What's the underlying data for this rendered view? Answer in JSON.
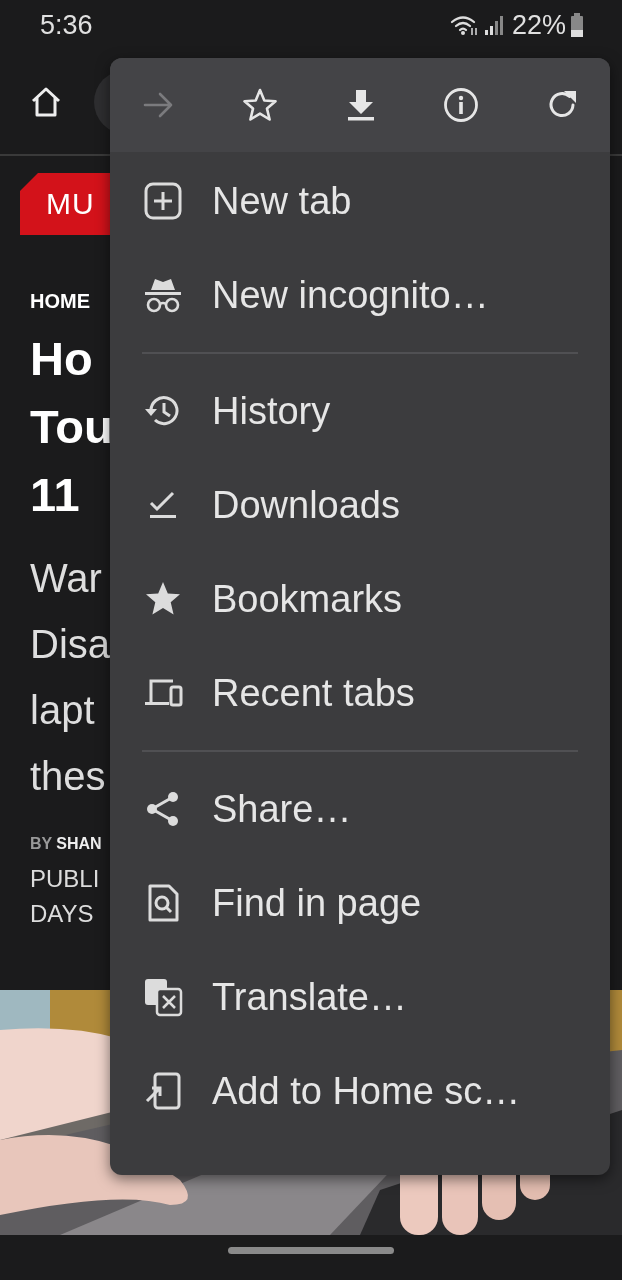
{
  "status_bar": {
    "time": "5:36",
    "battery": "22%"
  },
  "site": {
    "logo": "MU",
    "breadcrumb": "HOME",
    "title_lines": [
      "Ho",
      "Tou",
      "11"
    ],
    "summary_lines": [
      "War",
      "Disa",
      "lapt",
      "thes"
    ],
    "byline_label": "BY",
    "byline_name": "SHAN",
    "published_lines": [
      "PUBLI",
      "DAYS"
    ],
    "image": {
      "kind": "picture"
    }
  },
  "menu": {
    "toolbar": [
      {
        "kind": "forward",
        "disabled": true
      },
      {
        "kind": "bookmark",
        "disabled": false
      },
      {
        "kind": "download",
        "disabled": false
      },
      {
        "kind": "info",
        "disabled": false
      },
      {
        "kind": "refresh",
        "disabled": false
      }
    ],
    "items": [
      {
        "kind": "item",
        "label": "New tab"
      },
      {
        "kind": "item",
        "label": "New incognito…"
      },
      {
        "kind": "divider"
      },
      {
        "kind": "item",
        "label": "History"
      },
      {
        "kind": "item",
        "label": "Downloads"
      },
      {
        "kind": "item",
        "label": "Bookmarks"
      },
      {
        "kind": "item",
        "label": "Recent tabs"
      },
      {
        "kind": "divider"
      },
      {
        "kind": "item",
        "label": "Share…"
      },
      {
        "kind": "item",
        "label": "Find in page"
      },
      {
        "kind": "item",
        "label": "Translate…"
      },
      {
        "kind": "item",
        "label": "Add to Home sc…"
      }
    ]
  }
}
